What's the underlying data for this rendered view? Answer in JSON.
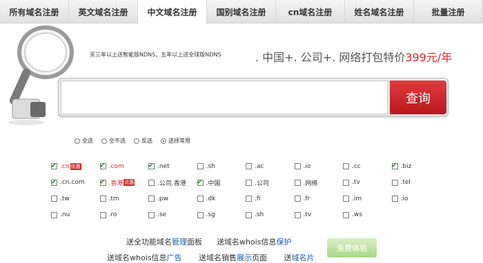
{
  "tabs": [
    "所有域名注册",
    "英文域名注册",
    "中文域名注册",
    "国别域名注册",
    "cn域名注册",
    "姓名域名注册",
    "批量注册"
  ],
  "active_tab_index": 2,
  "promo": {
    "small_text": "买三年以上送智能版NDNS，五年以上送全球版NDNS",
    "big_text": ". 中国+. 公司+. 网络打包特价",
    "price": "399元/年"
  },
  "search": {
    "placeholder": "",
    "value": "",
    "button_label": "查询"
  },
  "radios": [
    {
      "label": "全选",
      "selected": false
    },
    {
      "label": "全不选",
      "selected": false
    },
    {
      "label": "反选",
      "selected": false
    },
    {
      "label": "选择常用",
      "selected": true
    }
  ],
  "tlds": [
    {
      "label": ".cn",
      "checked": true,
      "red": true,
      "tag": "优惠"
    },
    {
      "label": ".com",
      "checked": true,
      "red": true,
      "tag": ""
    },
    {
      "label": ".net",
      "checked": true,
      "red": false,
      "tag": ""
    },
    {
      "label": ".sh",
      "checked": false,
      "red": false,
      "tag": ""
    },
    {
      "label": ".ac",
      "checked": false,
      "red": false,
      "tag": ""
    },
    {
      "label": ".io",
      "checked": false,
      "red": false,
      "tag": ""
    },
    {
      "label": ".cc",
      "checked": false,
      "red": false,
      "tag": ""
    },
    {
      "label": ".biz",
      "checked": true,
      "red": false,
      "tag": ""
    },
    {
      "label": ".cn.com",
      "checked": true,
      "red": false,
      "tag": ""
    },
    {
      "label": ".香港",
      "checked": true,
      "red": true,
      "tag": "优惠"
    },
    {
      "label": ".公司.香港",
      "checked": false,
      "red": false,
      "tag": ""
    },
    {
      "label": ".中国",
      "checked": true,
      "red": false,
      "tag": ""
    },
    {
      "label": ".公司",
      "checked": false,
      "red": false,
      "tag": ""
    },
    {
      "label": ".网络",
      "checked": false,
      "red": false,
      "tag": ""
    },
    {
      "label": ".tv",
      "checked": false,
      "red": false,
      "tag": ""
    },
    {
      "label": ".tel",
      "checked": false,
      "red": false,
      "tag": ""
    },
    {
      "label": ".tw",
      "checked": false,
      "red": false,
      "tag": ""
    },
    {
      "label": ".tm",
      "checked": false,
      "red": false,
      "tag": ""
    },
    {
      "label": ".pw",
      "checked": false,
      "red": false,
      "tag": ""
    },
    {
      "label": ".dk",
      "checked": false,
      "red": false,
      "tag": ""
    },
    {
      "label": ".fi",
      "checked": false,
      "red": false,
      "tag": ""
    },
    {
      "label": ".fr",
      "checked": false,
      "red": false,
      "tag": ""
    },
    {
      "label": ".im",
      "checked": false,
      "red": false,
      "tag": ""
    },
    {
      "label": ".io",
      "checked": false,
      "red": false,
      "tag": ""
    },
    {
      "label": ".nu",
      "checked": false,
      "red": false,
      "tag": ""
    },
    {
      "label": ".ro",
      "checked": false,
      "red": false,
      "tag": ""
    },
    {
      "label": ".se",
      "checked": false,
      "red": false,
      "tag": ""
    },
    {
      "label": ".sg",
      "checked": false,
      "red": false,
      "tag": ""
    },
    {
      "label": ".sh",
      "checked": false,
      "red": false,
      "tag": ""
    },
    {
      "label": ".tv",
      "checked": false,
      "red": false,
      "tag": ""
    },
    {
      "label": ".ws",
      "checked": false,
      "red": false,
      "tag": ""
    }
  ],
  "bottom": {
    "line1": {
      "pre1": "送全功能域名",
      "link1": "管理",
      "post1": "面板",
      "pre2": "送域名whois信息",
      "link2": "保护"
    },
    "line2": {
      "pre1": "送域名whois信息",
      "link1": "广告",
      "pre2": "送域名销售",
      "link2": "展示",
      "post2": "页面",
      "pre3": "送",
      "link3": "域名片"
    },
    "free_button": "免费体验"
  },
  "colors": {
    "accent_red": "#d8272a",
    "link_blue": "#1a58a8",
    "check_green": "#1a8a1a"
  }
}
